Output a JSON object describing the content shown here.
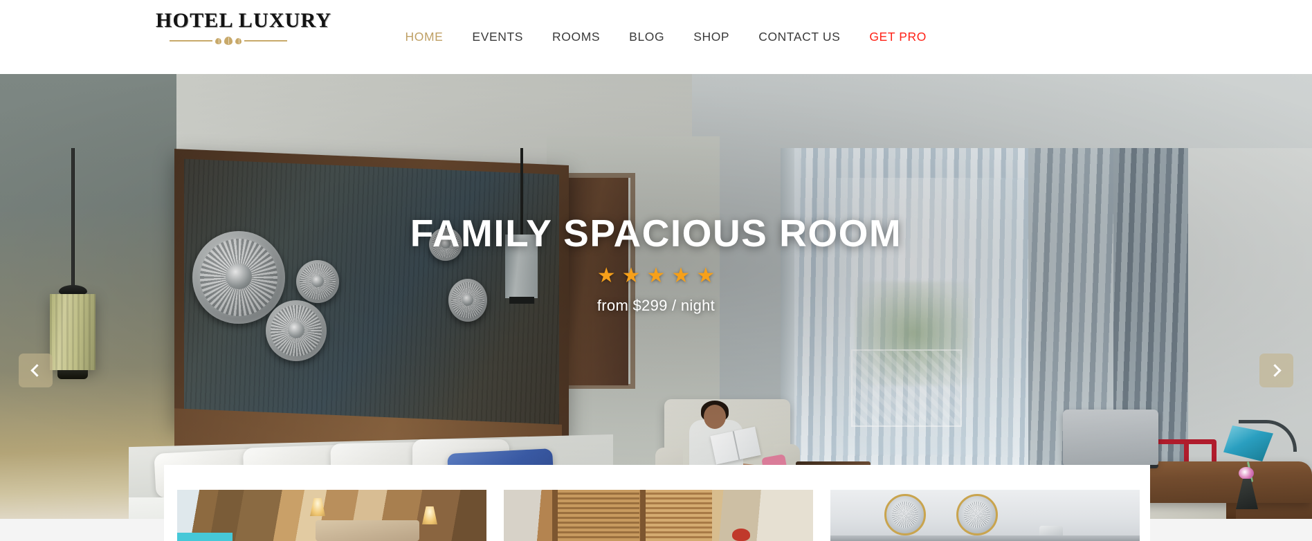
{
  "header": {
    "logo": {
      "text": "HOTEL LUXURY",
      "ornament_icon": "diamond-divider"
    },
    "nav": [
      {
        "label": "HOME",
        "state": "active"
      },
      {
        "label": "EVENTS",
        "state": "default"
      },
      {
        "label": "ROOMS",
        "state": "default"
      },
      {
        "label": "BLOG",
        "state": "default"
      },
      {
        "label": "SHOP",
        "state": "default"
      },
      {
        "label": "CONTACT US",
        "state": "default"
      },
      {
        "label": "GET PRO",
        "state": "promo"
      }
    ]
  },
  "hero": {
    "title": "FAMILY SPACIOUS ROOM",
    "rating": 5,
    "star_glyph": "★",
    "price": "from $299 / night",
    "prev_icon": "chevron-left-icon",
    "next_icon": "chevron-right-icon"
  },
  "cards": [
    {
      "alt": "warm bedroom with wall lamps"
    },
    {
      "alt": "room with wooden shutters"
    },
    {
      "alt": "white wall with round art"
    }
  ],
  "colors": {
    "accent_gold": "#bfa065",
    "promo_red": "#ff2116",
    "star_gold": "#f6a01a",
    "nav_text": "#3a3a3a",
    "page_bg": "#f4f4f4",
    "ornament": "#c8a96a"
  }
}
